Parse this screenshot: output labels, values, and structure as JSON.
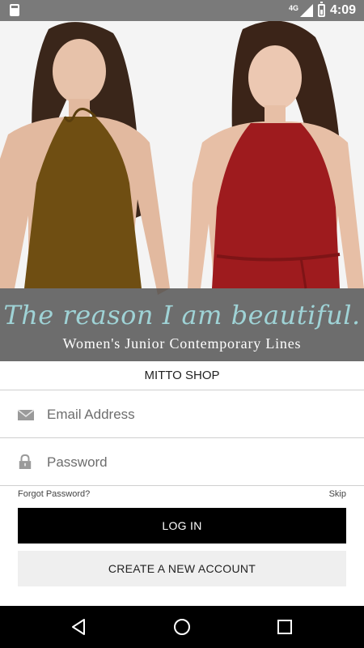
{
  "status_bar": {
    "network": "4G",
    "time": "4:09",
    "icons": [
      "sd-card-icon",
      "signal-icon",
      "battery-icon"
    ]
  },
  "hero": {
    "tagline": "The reason I am beautiful.",
    "subtagline": "Women's Junior Contemporary Lines",
    "colors": {
      "olive_dress": "#6f4e12",
      "red_dress": "#9e1b1e",
      "band": "#464646",
      "tagline": "#9fd3d6"
    }
  },
  "shop_title": "MITTO SHOP",
  "login_form": {
    "email_placeholder": "Email Address",
    "password_placeholder": "Password",
    "forgot_label": "Forgot Password?",
    "skip_label": "Skip",
    "login_label": "LOG IN",
    "create_label": "CREATE A NEW ACCOUNT"
  },
  "nav_bar": {
    "icons": [
      "back-icon",
      "home-icon",
      "recents-icon"
    ]
  }
}
